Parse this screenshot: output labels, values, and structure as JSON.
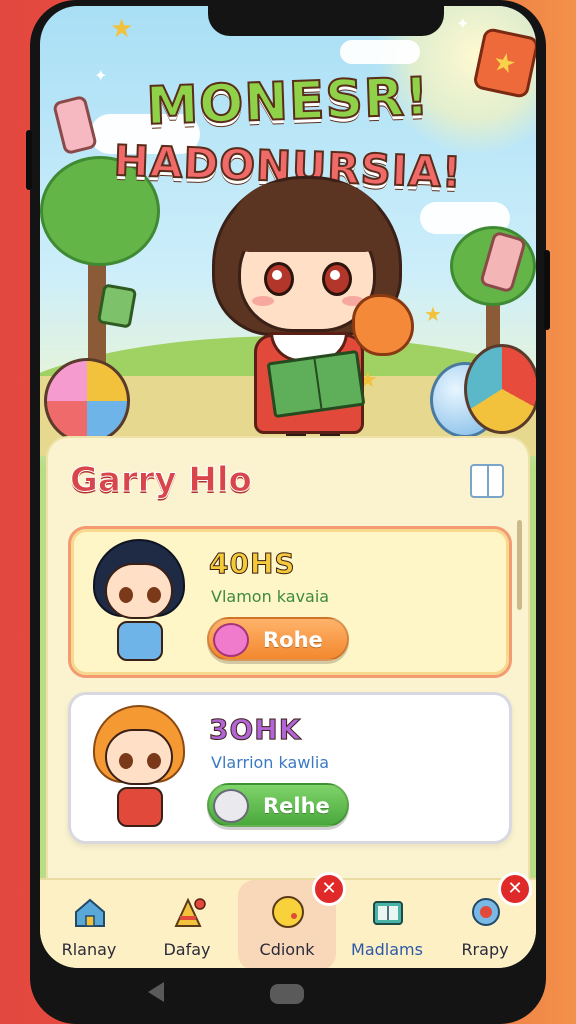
{
  "hero": {
    "title_line1": "MONESR!",
    "title_line2": "HADONURSIA!"
  },
  "panel": {
    "title": "Garry Hlo"
  },
  "cards": [
    {
      "heading": "40HS",
      "subtitle": "Vlamon kavaia",
      "button_label": "Rohe"
    },
    {
      "heading": "3OHK",
      "subtitle": "Vlarrion kawlia",
      "button_label": "Relhe"
    }
  ],
  "nav": {
    "items": [
      {
        "label": "Rlanay",
        "icon": "house-icon"
      },
      {
        "label": "Dafay",
        "icon": "flag-icon"
      },
      {
        "label": "Cdionk",
        "icon": "smiley-icon",
        "active": true
      },
      {
        "label": "Madlams",
        "icon": "book-icon"
      },
      {
        "label": "Rrapy",
        "icon": "map-pin-icon"
      }
    ],
    "badge_symbol": "✕"
  },
  "colors": {
    "accent_red": "#d8454a",
    "card1_button": "#f3882f",
    "card2_button": "#4aa83c",
    "badge": "#e02a2a"
  }
}
